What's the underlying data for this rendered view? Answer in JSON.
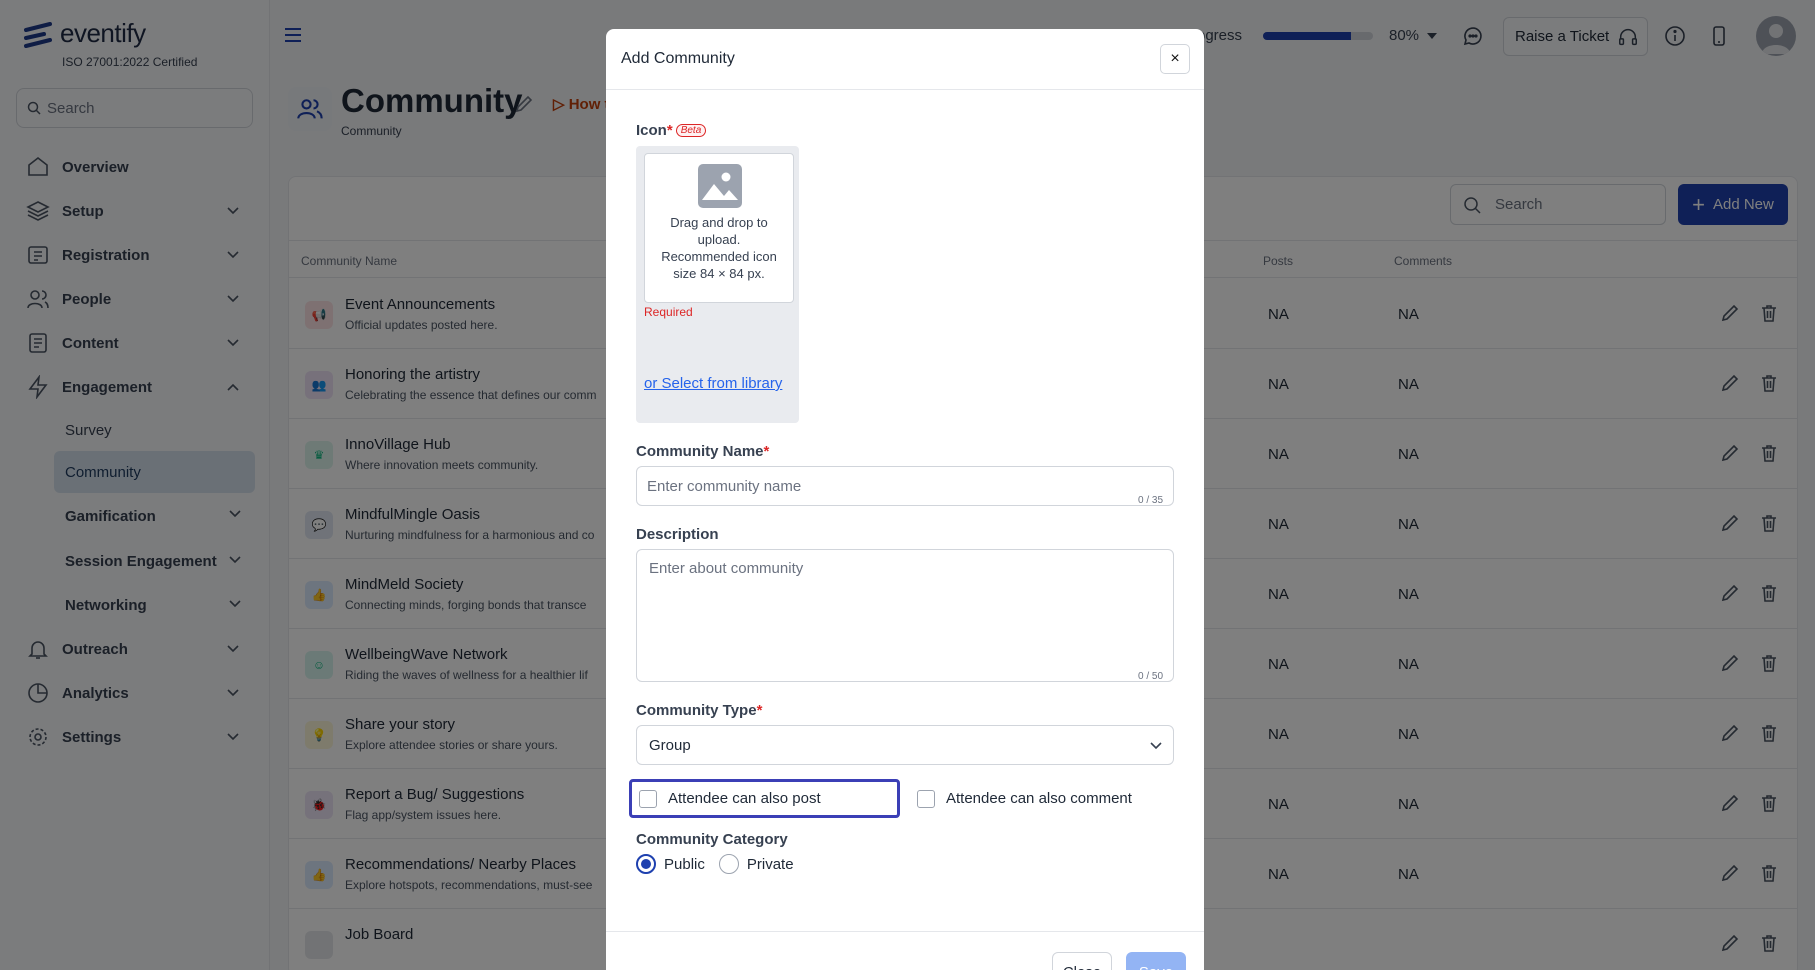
{
  "brand": {
    "name": "eventify",
    "cert": "ISO 27001:2022 Certified"
  },
  "sidebar": {
    "search_placeholder": "Search",
    "items": [
      {
        "label": "Overview",
        "icon": "home-icon"
      },
      {
        "label": "Setup",
        "icon": "layers-icon"
      },
      {
        "label": "Registration",
        "icon": "ticket-icon"
      },
      {
        "label": "People",
        "icon": "people-icon"
      },
      {
        "label": "Content",
        "icon": "content-icon"
      },
      {
        "label": "Engagement",
        "icon": "bolt-icon"
      },
      {
        "label": "Outreach",
        "icon": "bell-icon"
      },
      {
        "label": "Analytics",
        "icon": "pie-chart-icon"
      },
      {
        "label": "Settings",
        "icon": "gear-icon"
      }
    ],
    "engagement_sub": [
      "Survey",
      "Community",
      "Gamification",
      "Session Engagement",
      "Networking"
    ]
  },
  "topbar": {
    "progress_label": "rogress",
    "progress_value": "80%",
    "progress_fraction": 0.8,
    "ticket_label": "Raise a Ticket"
  },
  "page": {
    "title": "Community",
    "breadcrumb": "Community",
    "howto": "How t",
    "search_placeholder": "Search",
    "add_new": "Add New"
  },
  "table": {
    "columns": [
      "Community Name",
      "Posts",
      "Comments"
    ],
    "rows": [
      {
        "name": "Event Announcements",
        "desc": "Official updates posted here.",
        "posts": "NA",
        "comments": "NA",
        "icon": "megaphone-icon",
        "color": "#fde2e4",
        "fg": "#e11d48",
        "glyph": "📢"
      },
      {
        "name": "Honoring the artistry",
        "desc": "Celebrating the essence that defines our comm",
        "posts": "NA",
        "comments": "NA",
        "icon": "people-icon",
        "color": "#efe3f7",
        "fg": "#9333ea",
        "glyph": "👥"
      },
      {
        "name": "InnoVillage Hub",
        "desc": "Where innovation meets community.",
        "posts": "NA",
        "comments": "NA",
        "icon": "crown-icon",
        "color": "#dcf5ec",
        "fg": "#10b981",
        "glyph": "♛"
      },
      {
        "name": "MindfulMingle Oasis",
        "desc": "Nurturing mindfulness for a harmonious and co",
        "posts": "NA",
        "comments": "NA",
        "icon": "chat-icon",
        "color": "#e0e7f3",
        "fg": "#1e40af",
        "glyph": "💬"
      },
      {
        "name": "MindMeld Society",
        "desc": "Connecting minds, forging bonds that transce",
        "posts": "NA",
        "comments": "NA",
        "icon": "thumbs-up-icon",
        "color": "#dbeafe",
        "fg": "#2563eb",
        "glyph": "👍"
      },
      {
        "name": "WellbeingWave Network",
        "desc": "Riding the waves of wellness for a healthier lif",
        "posts": "NA",
        "comments": "NA",
        "icon": "smile-icon",
        "color": "#d7f5ee",
        "fg": "#10b981",
        "glyph": "☺"
      },
      {
        "name": "Share your story",
        "desc": "Explore attendee stories or share yours.",
        "posts": "NA",
        "comments": "NA",
        "icon": "bulb-icon",
        "color": "#fdf6d8",
        "fg": "#eab308",
        "glyph": "💡"
      },
      {
        "name": "Report a Bug/ Suggestions",
        "desc": "Flag app/system issues here.",
        "posts": "NA",
        "comments": "NA",
        "icon": "bug-icon",
        "color": "#ede4f7",
        "fg": "#7c3aed",
        "glyph": "🐞"
      },
      {
        "name": "Recommendations/ Nearby Places",
        "desc": "Explore hotspots, recommendations, must-see",
        "posts": "NA",
        "comments": "NA",
        "icon": "thumbs-up-icon",
        "color": "#dbeafe",
        "fg": "#2563eb",
        "glyph": "👍"
      },
      {
        "name": "Job Board",
        "desc": "",
        "posts": "",
        "comments": "",
        "icon": "briefcase-icon",
        "color": "#e5e7eb",
        "fg": "#374151",
        "glyph": ""
      }
    ]
  },
  "modal": {
    "title": "Add Community",
    "close_x": "×",
    "icon_label": "Icon",
    "beta": "Beta",
    "dropzone_text": "Drag and drop to upload. Recommended icon size 84 × 84 px.",
    "required_msg": "Required",
    "library_link": "or Select from library",
    "name_label": "Community Name",
    "name_placeholder": "Enter community name",
    "name_counter": "0 / 35",
    "desc_label": "Description",
    "desc_placeholder": "Enter about community",
    "desc_counter": "0 / 50",
    "type_label": "Community Type",
    "type_value": "Group",
    "can_post": "Attendee can also post",
    "can_comment": "Attendee can also comment",
    "category_label": "Community Category",
    "public": "Public",
    "private": "Private",
    "close_btn": "Close",
    "save_btn": "Save",
    "required_mark": "*"
  },
  "colors": {
    "accent": "#1e40af",
    "danger": "#dc2626",
    "link": "#2563eb",
    "focus": "#3b3fb6"
  }
}
